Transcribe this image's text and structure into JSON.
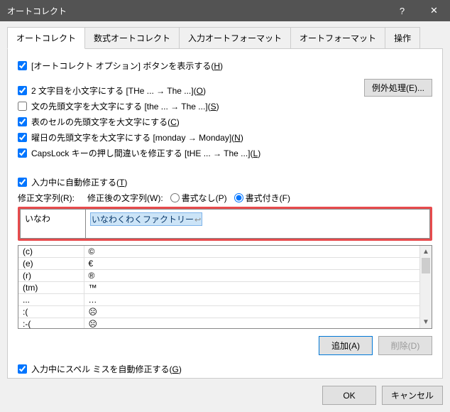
{
  "title": "オートコレクト",
  "titlebar": {
    "help_label": "?",
    "close_label": "✕"
  },
  "tabs": [
    "オートコレクト",
    "数式オートコレクト",
    "入力オートフォーマット",
    "オートフォーマット",
    "操作"
  ],
  "active_tab": 0,
  "checks": {
    "show_btn": {
      "checked": true,
      "label": "[オートコレクト オプション] ボタンを表示する(",
      "ul": "H",
      "suf": ")"
    },
    "cap2": {
      "checked": true,
      "label": "2 文字目を小文字にする [THe ... → The ...](",
      "ul": "O",
      "suf": ")"
    },
    "sent": {
      "checked": false,
      "label": "文の先頭文字を大文字にする [the ... → The ...](",
      "ul": "S",
      "suf": ")"
    },
    "tblcell": {
      "checked": true,
      "label": "表のセルの先頭文字を大文字にする(",
      "ul": "C",
      "suf": ")"
    },
    "day": {
      "checked": true,
      "label": "曜日の先頭文字を大文字にする [monday → Monday](",
      "ul": "N",
      "suf": ")"
    },
    "caps": {
      "checked": true,
      "label": "CapsLock キーの押し間違いを修正する [tHE ... → The ...](",
      "ul": "L",
      "suf": ")"
    },
    "replace": {
      "checked": true,
      "label": "入力中に自動修正する(",
      "ul": "T",
      "suf": ")"
    },
    "spell": {
      "checked": true,
      "label": "入力中にスペル ミスを自動修正する(",
      "ul": "G",
      "suf": ")"
    }
  },
  "exceptions_btn": "例外処理(E)...",
  "row_labels": {
    "rep": "修正文字列(R):",
    "with": "修正後の文字列(W):"
  },
  "radios": {
    "plain": "書式なし(P)",
    "formatted": "書式付き(F)",
    "selected": "formatted"
  },
  "input": {
    "find": "いなわ",
    "repl_sel": "いなわくわくファクトリー"
  },
  "list": [
    {
      "k": "(c)",
      "v": "©"
    },
    {
      "k": "(e)",
      "v": "€"
    },
    {
      "k": "(r)",
      "v": "®"
    },
    {
      "k": "(tm)",
      "v": "™"
    },
    {
      "k": "...",
      "v": "…"
    },
    {
      "k": ":(",
      "v": "☹"
    },
    {
      "k": ":-(",
      "v": "☹"
    }
  ],
  "buttons": {
    "add": "追加(A)",
    "del": "削除(D)",
    "ok": "OK",
    "cancel": "キャンセル"
  }
}
